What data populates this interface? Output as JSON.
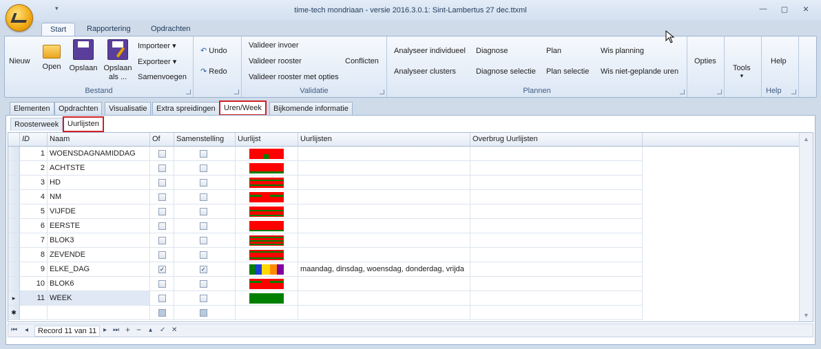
{
  "window": {
    "title": "time-tech mondriaan - versie 2016.3.0.1: Sint-Lambertus 27 dec.ttxml",
    "quick_access": "▾",
    "minimize": "—",
    "maximize": "▢",
    "close": "✕"
  },
  "ribbon_tabs": [
    "Start",
    "Rapportering",
    "Opdrachten"
  ],
  "ribbon": {
    "bestand": {
      "title": "Bestand",
      "nieuw": "Nieuw",
      "open": "Open",
      "opslaan": "Opslaan",
      "opslaan_als_1": "Opslaan",
      "opslaan_als_2": "als ...",
      "importeer": "Importeer ▾",
      "exporteer": "Exporteer ▾",
      "samenvoegen": "Samenvoegen"
    },
    "edit": {
      "undo": "Undo",
      "redo": "Redo"
    },
    "validatie": {
      "title": "Validatie",
      "valideer_invoer": "Valideer invoer",
      "valideer_rooster": "Valideer rooster",
      "valideer_opties": "Valideer rooster met opties",
      "conflicten": "Conflicten"
    },
    "plannen": {
      "title": "Plannen",
      "analyseer_individueel": "Analyseer individueel",
      "analyseer_clusters": "Analyseer clusters",
      "diagnose": "Diagnose",
      "diagnose_selectie": "Diagnose selectie",
      "plan": "Plan",
      "plan_selectie": "Plan selectie",
      "wis_planning": "Wis planning",
      "wis_niet_geplande": "Wis niet-geplande uren"
    },
    "opties": "Opties",
    "tools": "Tools",
    "tools_arrow": "▾",
    "help": {
      "button": "Help",
      "title": "Help"
    }
  },
  "content_tabs": [
    "Elementen",
    "Opdrachten",
    "Visualisatie",
    "Extra spreidingen",
    "Uren/Week",
    "Bijkomende informatie"
  ],
  "sub_tabs": [
    "Roosterweek",
    "Uurlijsten"
  ],
  "grid": {
    "columns": [
      "ID",
      "Naam",
      "Of",
      "Samenstelling",
      "Uurlijst",
      "Uurlijsten",
      "Overbrug Uurlijsten"
    ],
    "rows": [
      {
        "id": "1",
        "naam": "WOENSDAGNAMIDDAG",
        "of": false,
        "sam": false,
        "uurlijsten": ""
      },
      {
        "id": "2",
        "naam": "ACHTSTE",
        "of": false,
        "sam": false,
        "uurlijsten": ""
      },
      {
        "id": "3",
        "naam": "HD",
        "of": false,
        "sam": false,
        "uurlijsten": ""
      },
      {
        "id": "4",
        "naam": "NM",
        "of": false,
        "sam": false,
        "uurlijsten": ""
      },
      {
        "id": "5",
        "naam": "VIJFDE",
        "of": false,
        "sam": false,
        "uurlijsten": ""
      },
      {
        "id": "6",
        "naam": "EERSTE",
        "of": false,
        "sam": false,
        "uurlijsten": ""
      },
      {
        "id": "7",
        "naam": "BLOK3",
        "of": false,
        "sam": false,
        "uurlijsten": ""
      },
      {
        "id": "8",
        "naam": "ZEVENDE",
        "of": false,
        "sam": false,
        "uurlijsten": ""
      },
      {
        "id": "9",
        "naam": "ELKE_DAG",
        "of": true,
        "sam": true,
        "uurlijsten": "maandag, dinsdag, woensdag, donderdag, vrijda"
      },
      {
        "id": "10",
        "naam": "BLOK6",
        "of": false,
        "sam": false,
        "uurlijsten": ""
      },
      {
        "id": "11",
        "naam": "WEEK",
        "of": false,
        "sam": false,
        "uurlijsten": ""
      }
    ],
    "new_row_marker": "✱",
    "current_row_marker": "▸"
  },
  "navigator": {
    "record": "Record 11 van 11",
    "first": "⏮",
    "prev": "◂",
    "next": "▸",
    "last": "⏭",
    "add": "+",
    "remove": "−",
    "up": "▴",
    "save": "✓",
    "cancel": "✕"
  },
  "colors": {
    "red": "#ff0000",
    "green": "#008000",
    "blue": "#1f3fd0",
    "yellow": "#ffd800",
    "orange": "#ff8c00",
    "purple": "#8000a0"
  }
}
